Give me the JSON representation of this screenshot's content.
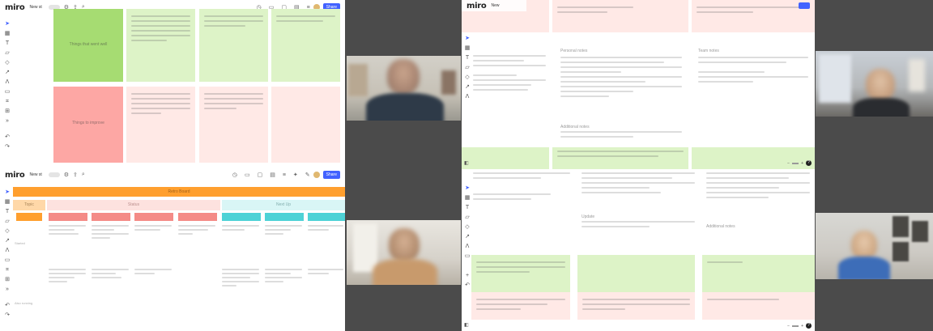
{
  "app": {
    "logo": "miro",
    "board_name_short": "New"
  },
  "top_left": {
    "board_name": "New st",
    "share_label": "Share",
    "stickies": [
      {
        "label": "Things that went well"
      },
      {
        "label": "Things to improve"
      }
    ]
  },
  "bottom_left": {
    "board_name": "New st",
    "share_label": "Share",
    "banner_label": "Retro Board",
    "col_headers": [
      "Topic",
      "Status",
      "Next Up"
    ],
    "row_labels": [
      "Started",
      "Also running"
    ],
    "zoom_symbols": [
      "−",
      "+"
    ]
  },
  "top_right": {
    "board_name": "New",
    "sections": [
      "Personal notes",
      "Team notes",
      "Additional notes"
    ],
    "zoom_symbols": [
      "−",
      "+"
    ],
    "help_label": "?"
  },
  "bottom_right": {
    "sections": [
      "Update",
      "Additional notes"
    ],
    "zoom_symbols": [
      "−",
      "+"
    ],
    "help_label": "?"
  },
  "colors": {
    "miro_blue": "#4262ff",
    "sticky_green": "#ddf3c7",
    "sticky_green_dark": "#a6dc72",
    "sticky_pink": "#ffe9e6",
    "sticky_red": "#fda7a4",
    "banner_orange": "#ff9f2e",
    "header_teal": "#4ed2d6"
  }
}
